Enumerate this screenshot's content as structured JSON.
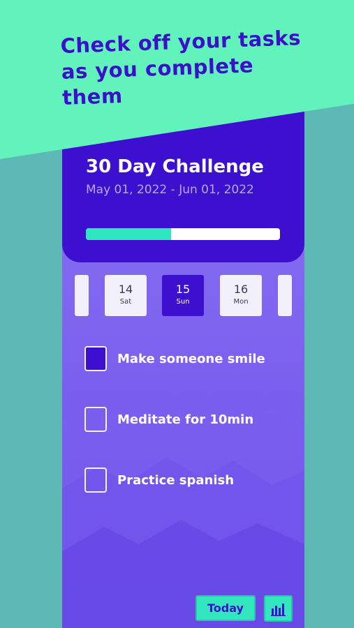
{
  "promo": {
    "headline_line1": "Check off your tasks",
    "headline_line2": "as you complete",
    "headline_line3": "them"
  },
  "challenge": {
    "title": "30 Day Challenge",
    "date_range": "May 01, 2022 - Jun 01, 2022",
    "progress_fraction": 0.44
  },
  "days": [
    {
      "num": "14",
      "dow": "Sat",
      "selected": false
    },
    {
      "num": "15",
      "dow": "Sun",
      "selected": true
    },
    {
      "num": "16",
      "dow": "Mon",
      "selected": false
    }
  ],
  "tasks": [
    {
      "label": "Make someone smile",
      "checked": true
    },
    {
      "label": "Meditate for 10min",
      "checked": false
    },
    {
      "label": "Practice spanish",
      "checked": false
    }
  ],
  "footer": {
    "today_label": "Today",
    "stats_icon": "bar-chart-icon"
  },
  "colors": {
    "background_teal": "#5db8b6",
    "banner_mint": "#62f2bc",
    "primary_indigo": "#3d10cf",
    "accent_aqua": "#32e6c0",
    "panel_violet": "#8a73f2"
  }
}
